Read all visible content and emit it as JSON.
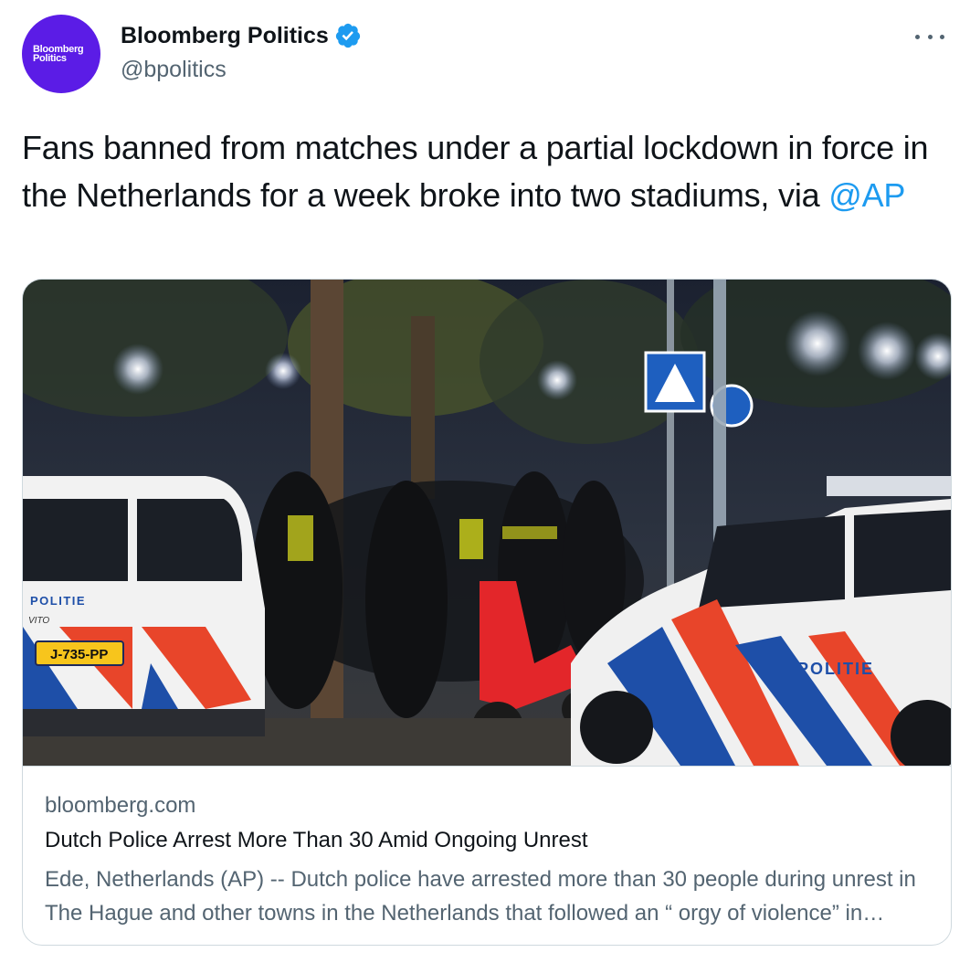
{
  "author": {
    "avatar_text": "Bloomberg Politics",
    "name": "Bloomberg Politics",
    "handle": "@bpolitics",
    "verified": true
  },
  "more_icon": "more-horizontal-icon",
  "tweet": {
    "text": "Fans banned from matches under a partial lockdown in force in the Netherlands for a week broke into two stadiums, via ",
    "mention": "@AP"
  },
  "card": {
    "image_signs": {
      "politie_left": "POLITIE",
      "plate": "J-735-PP",
      "vito": "VITO",
      "politie_right": "POLITIE"
    },
    "domain": "bloomberg.com",
    "title": "Dutch Police Arrest More Than 30 Amid Ongoing Unrest",
    "description": "Ede, Netherlands (AP) -- Dutch police have arrested more than 30 people during unrest in The Hague and other towns in the Netherlands that followed an “ orgy of violence” in Rotterdam."
  },
  "colors": {
    "brand_purple": "#5b1ce6",
    "link_blue": "#1d9bf0",
    "muted_text": "#536471",
    "border": "#cfd9de"
  }
}
